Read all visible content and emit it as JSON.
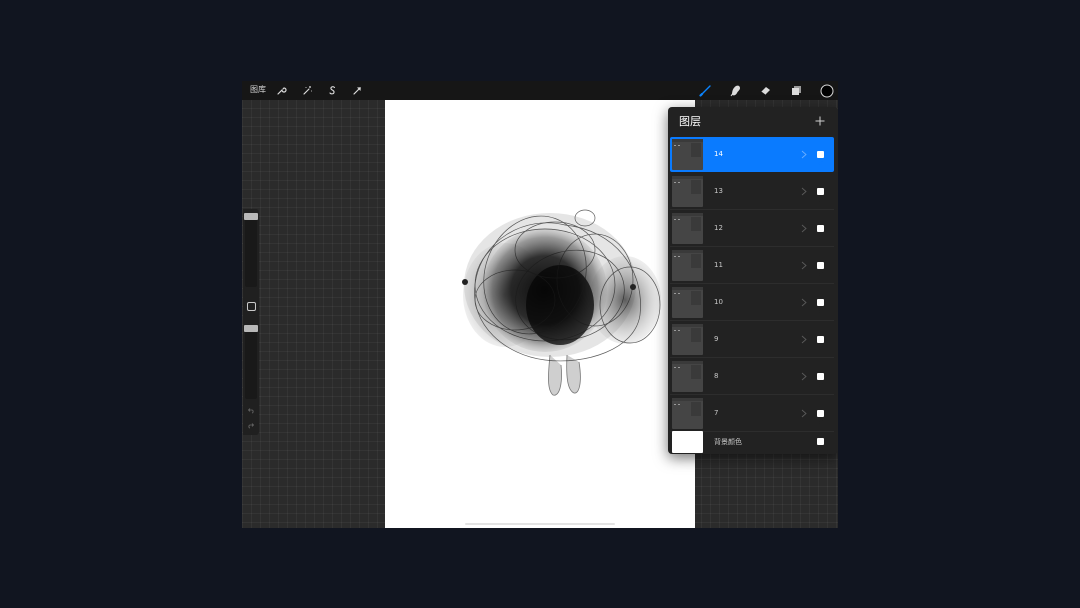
{
  "toolbar": {
    "gallery_label": "图库",
    "left_icons": [
      "wrench-icon",
      "magic-wand-icon",
      "selection-icon",
      "transform-arrow-icon"
    ],
    "right_icons": [
      "brush-icon",
      "smudge-icon",
      "eraser-icon",
      "layers-icon",
      "color-swatch"
    ],
    "active_tool_color": "#0a84ff",
    "current_color": "#000000"
  },
  "layers_panel": {
    "title": "图层",
    "add_icon": "plus-icon",
    "layers": [
      {
        "name": "14",
        "selected": true,
        "visible": true
      },
      {
        "name": "13",
        "selected": false,
        "visible": true
      },
      {
        "name": "12",
        "selected": false,
        "visible": true
      },
      {
        "name": "11",
        "selected": false,
        "visible": true
      },
      {
        "name": "10",
        "selected": false,
        "visible": true
      },
      {
        "name": "9",
        "selected": false,
        "visible": true
      },
      {
        "name": "8",
        "selected": false,
        "visible": true
      },
      {
        "name": "7",
        "selected": false,
        "visible": true
      }
    ],
    "background_layer": {
      "name": "背景颜色",
      "visible": true,
      "color": "#ffffff"
    },
    "selected_color": "#0a7bff"
  },
  "sidebar": {
    "brush_size_level": 0.0,
    "opacity_level": 0.0,
    "icons": [
      "modify-square-icon",
      "undo-icon",
      "redo-icon"
    ]
  },
  "colors": {
    "page_background": "#111520",
    "app_background": "#2b2b2b",
    "toolbar_background": "#161616",
    "panel_background": "#222222",
    "canvas_background": "#ffffff"
  }
}
